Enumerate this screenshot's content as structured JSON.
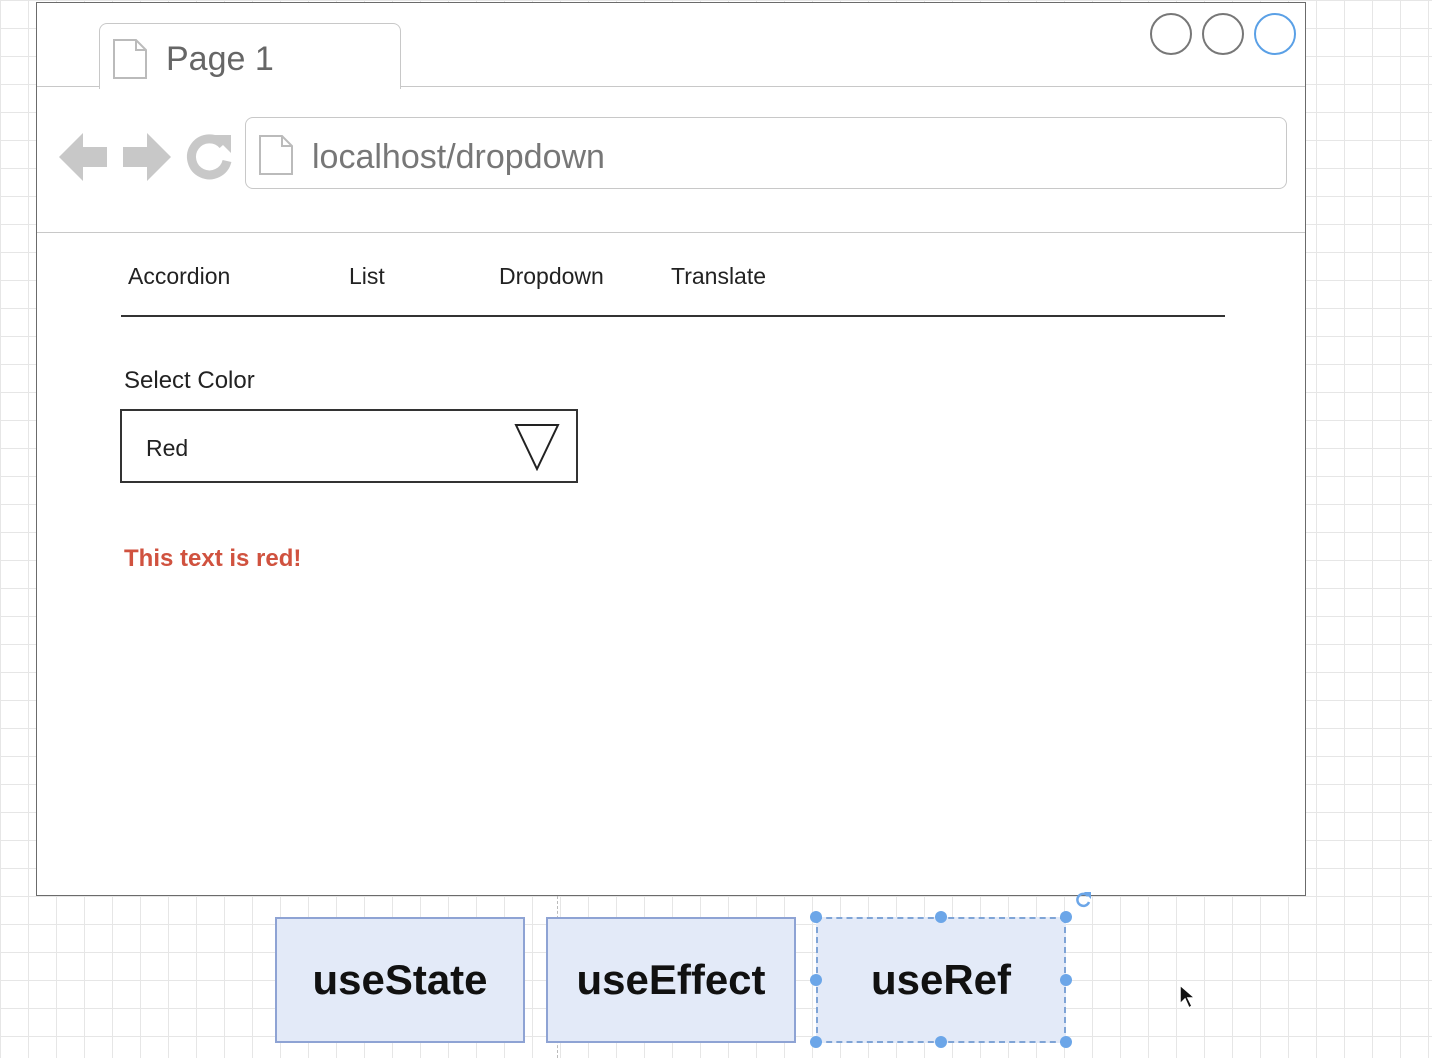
{
  "browser": {
    "tab_title": "Page 1",
    "url": "localhost/dropdown",
    "icons": [
      "page-icon",
      "back-arrow-icon",
      "forward-arrow-icon",
      "reload-icon",
      "document-icon"
    ]
  },
  "page": {
    "menu": [
      {
        "label": "Accordion"
      },
      {
        "label": "List"
      },
      {
        "label": "Dropdown"
      },
      {
        "label": "Translate"
      }
    ],
    "field_label": "Select Color",
    "selected_value": "Red",
    "message": "This text is red!",
    "message_color": "#d0523f"
  },
  "hooks": [
    {
      "label": "useState"
    },
    {
      "label": "useEffect"
    },
    {
      "label": "useRef",
      "selected": true
    }
  ],
  "colors": {
    "selection_blue": "#6ca6e8",
    "hook_fill": "#e3eaf8",
    "hook_border": "#8ea3d4"
  }
}
